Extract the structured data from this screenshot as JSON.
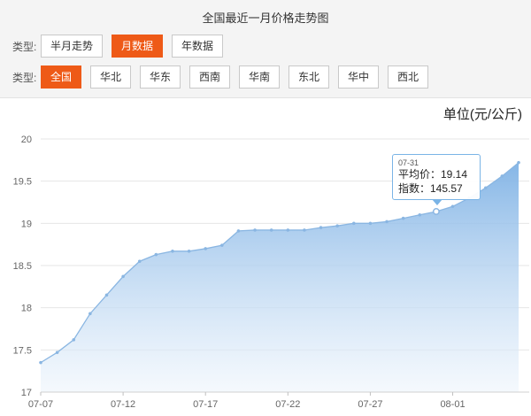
{
  "header": {
    "title": "全国最近一月价格走势图"
  },
  "filters": {
    "row1": {
      "label": "类型:",
      "options": [
        {
          "label": "半月走势",
          "active": false
        },
        {
          "label": "月数据",
          "active": true
        },
        {
          "label": "年数据",
          "active": false
        }
      ]
    },
    "row2": {
      "label": "类型:",
      "options": [
        {
          "label": "全国",
          "active": true
        },
        {
          "label": "华北",
          "active": false
        },
        {
          "label": "华东",
          "active": false
        },
        {
          "label": "西南",
          "active": false
        },
        {
          "label": "华南",
          "active": false
        },
        {
          "label": "东北",
          "active": false
        },
        {
          "label": "华中",
          "active": false
        },
        {
          "label": "西北",
          "active": false
        }
      ]
    }
  },
  "colors": {
    "accent": "#ee5a17",
    "line": "#8ab6e2",
    "area_top": "#7fb2e5",
    "area_bottom": "#eef5fc"
  },
  "tooltip": {
    "date": "07-31",
    "avg_line": "平均价：19.14",
    "index_line": "指数：145.57"
  },
  "chart_data": {
    "type": "area",
    "unit_label": "单位(元/公斤)",
    "ylim": [
      17,
      20
    ],
    "yticks": [
      "17",
      "17.5",
      "18",
      "18.5",
      "19",
      "19.5",
      "20"
    ],
    "x_tick_labels": [
      "07-07",
      "07-12",
      "07-17",
      "07-22",
      "07-27",
      "08-01"
    ],
    "x": [
      "07-07",
      "07-08",
      "07-09",
      "07-10",
      "07-11",
      "07-12",
      "07-13",
      "07-14",
      "07-15",
      "07-16",
      "07-17",
      "07-18",
      "07-19",
      "07-20",
      "07-21",
      "07-22",
      "07-23",
      "07-24",
      "07-25",
      "07-26",
      "07-27",
      "07-28",
      "07-29",
      "07-30",
      "07-31",
      "08-01",
      "08-02",
      "08-03",
      "08-04",
      "08-05"
    ],
    "values": [
      17.35,
      17.47,
      17.62,
      17.93,
      18.15,
      18.37,
      18.55,
      18.63,
      18.67,
      18.67,
      18.7,
      18.74,
      18.91,
      18.92,
      18.92,
      18.92,
      18.92,
      18.95,
      18.97,
      19.0,
      19.0,
      19.02,
      19.06,
      19.1,
      19.14,
      19.2,
      19.3,
      19.42,
      19.56,
      19.72
    ],
    "highlight_index": 24,
    "grid": true
  }
}
